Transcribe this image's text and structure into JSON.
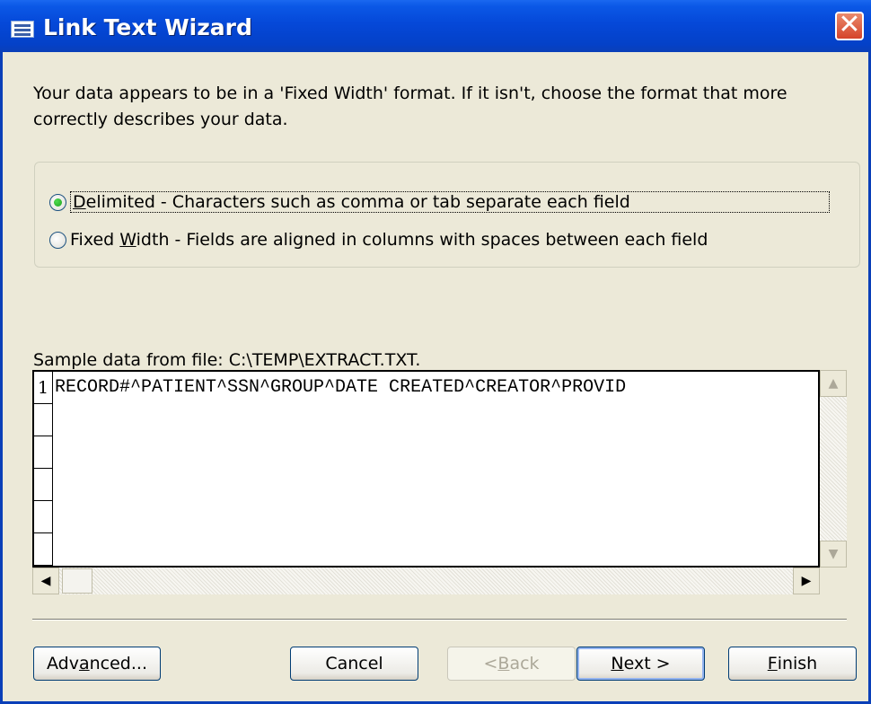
{
  "window": {
    "title": "Link Text Wizard",
    "close_glyph": "✕"
  },
  "intro_text": "Your data appears to be in a 'Fixed Width' format. If it isn't, choose the format that more correctly describes your data.",
  "options": {
    "delimited": {
      "pre": "",
      "key": "D",
      "post": "elimited - Characters such as comma or tab separate each field",
      "selected": true
    },
    "fixed_width": {
      "pre": "Fixed ",
      "key": "W",
      "post": "idth - Fields are aligned in columns with spaces between each field",
      "selected": false
    }
  },
  "sample": {
    "label": "Sample data from file: C:\\TEMP\\EXTRACT.TXT.",
    "row_numbers": [
      "1",
      "",
      "",
      "",
      "",
      "",
      ""
    ],
    "first_row_text": "RECORD#^PATIENT^SSN^GROUP^DATE CREATED^CREATOR^PROVID"
  },
  "scrollbars": {
    "up": "▲",
    "down": "▼",
    "left": "◀",
    "right": "▶"
  },
  "buttons": {
    "advanced": {
      "pre": "Adv",
      "key": "a",
      "post": "nced..."
    },
    "cancel": {
      "pre": "Cancel",
      "key": "",
      "post": ""
    },
    "back": {
      "pre": "< ",
      "key": "B",
      "post": "ack"
    },
    "next": {
      "pre": "",
      "key": "N",
      "post": "ext >"
    },
    "finish": {
      "pre": "",
      "key": "F",
      "post": "inish"
    }
  }
}
